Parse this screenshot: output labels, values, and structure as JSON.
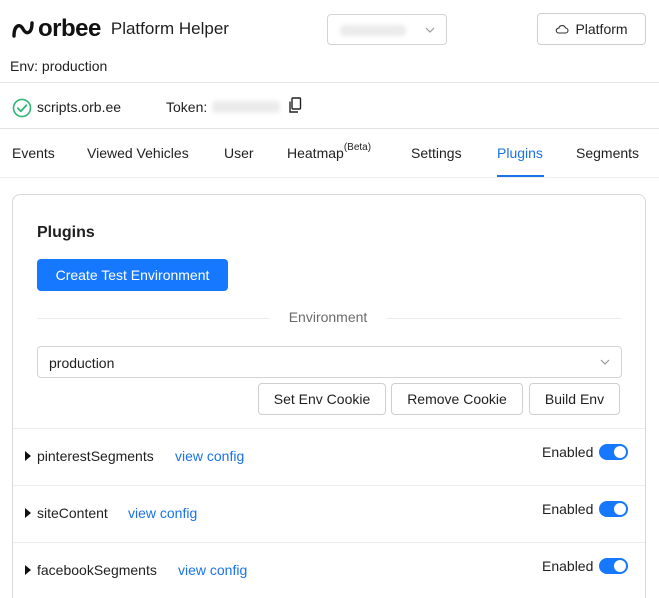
{
  "header": {
    "logo_text": "orbee",
    "app_title": "Platform Helper",
    "account_select": {
      "value_blurred": true,
      "icon": "chevron-down-icon"
    },
    "platform_button": {
      "label": "Platform",
      "icon": "cloud-icon"
    },
    "env_label": "Env: production"
  },
  "status": {
    "host": "scripts.orb.ee",
    "host_icon": "check-circle-icon",
    "token_label": "Token:",
    "token_value_blurred": true,
    "copy_icon": "copy-icon"
  },
  "tabs": [
    {
      "label": "Events",
      "sup": ""
    },
    {
      "label": "Viewed Vehicles",
      "sup": ""
    },
    {
      "label": "User",
      "sup": ""
    },
    {
      "label": "Heatmap",
      "sup": "(Beta)"
    },
    {
      "label": "Settings",
      "sup": ""
    },
    {
      "label": "Plugins",
      "sup": "",
      "active": true
    },
    {
      "label": "Segments",
      "sup": ""
    }
  ],
  "plugins_panel": {
    "title": "Plugins",
    "create_button": "Create Test Environment",
    "divider_label": "Environment",
    "env_select": {
      "value": "production"
    },
    "actions": {
      "set_cookie": "Set Env Cookie",
      "remove_cookie": "Remove Cookie",
      "build_env": "Build Env"
    },
    "plugins": [
      {
        "name": "pinterestSegments",
        "link": "view config",
        "status": "Enabled",
        "enabled": true
      },
      {
        "name": "siteContent",
        "link": "view config",
        "status": "Enabled",
        "enabled": true
      },
      {
        "name": "facebookSegments",
        "link": "view config",
        "status": "Enabled",
        "enabled": true
      }
    ]
  },
  "colors": {
    "accent": "#1677ff",
    "link": "#1a73e8",
    "success": "#2bb673",
    "border": "#d9d9d9"
  }
}
